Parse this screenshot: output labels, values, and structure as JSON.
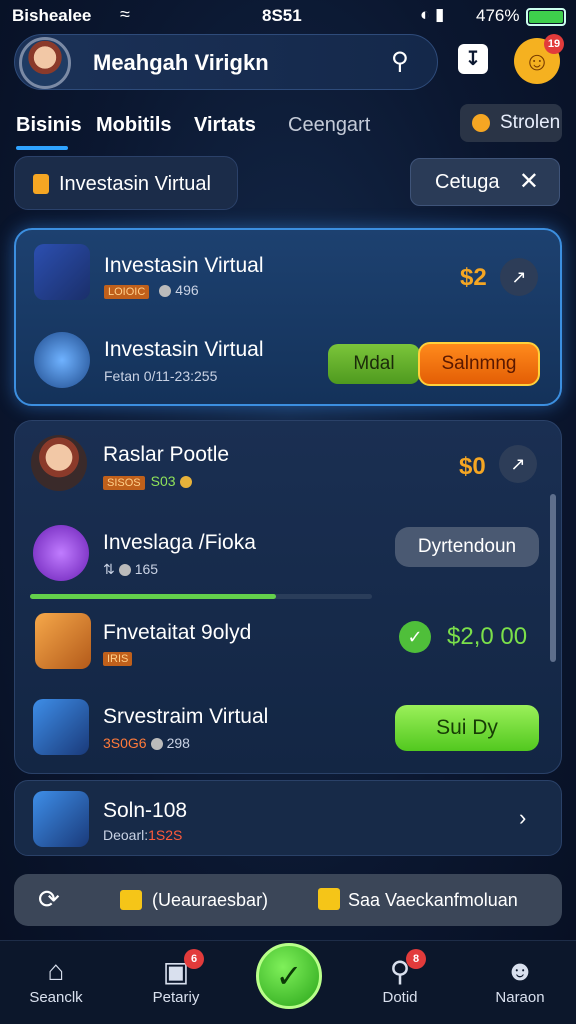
{
  "status_bar": {
    "carrier": "Bishealee",
    "time": "8S51",
    "battery_pct": "476%"
  },
  "header": {
    "user_name": "Meahgah Virigkn",
    "notification_count": "19"
  },
  "tabs": [
    {
      "label": "Bisinis"
    },
    {
      "label": "Mobitils"
    },
    {
      "label": "Virtats"
    },
    {
      "label": "Ceengart"
    }
  ],
  "stolen_button": {
    "label": "Strolen"
  },
  "filter": {
    "chip_label": "Investasin Virtual",
    "action_label": "Cetuga"
  },
  "featured": [
    {
      "title": "Investasin Virtual",
      "tag": "LOIOIC",
      "sub": "496",
      "amount": "$2"
    },
    {
      "title": "Investasin Virtual",
      "sub": "Fetan  0/11-23:255",
      "btn_green": "Mdal",
      "btn_orange": "Salnmng"
    }
  ],
  "list": [
    {
      "title": "Raslar Pootle",
      "tag": "SISOS",
      "sub": "S03",
      "amount": "$0"
    },
    {
      "title": "Inveslaga /Fioka",
      "sub": "165",
      "button": "Dyrtendoun",
      "progress": 0.72
    },
    {
      "title": "Fnvetaitat 9olyd",
      "tag": "IRIS",
      "amount": "$2,0 00"
    },
    {
      "title": "Srvestraim Virtual",
      "sub_red": "3S0G6",
      "sub": "298",
      "button": "Sui Dy"
    }
  ],
  "bottom_item": {
    "title": "Soln-108",
    "sub": "Deoarl:",
    "sub_red": "1S2S"
  },
  "banner": {
    "left": "(Ueauraesbar)",
    "right": "Saa Vaeckanfmoluan"
  },
  "nav": [
    {
      "label": "Seanclk",
      "icon": "home-icon"
    },
    {
      "label": "Petariy",
      "icon": "camera-icon",
      "badge": "6"
    },
    {
      "label": "",
      "icon": "check-icon"
    },
    {
      "label": "Dotid",
      "icon": "pin-icon",
      "badge": "8"
    },
    {
      "label": "Naraon",
      "icon": "user-icon"
    }
  ],
  "colors": {
    "accent_blue": "#3c8fe0",
    "amount_orange": "#f5a623",
    "green": "#52c81f",
    "orange_btn": "#e35e05"
  }
}
